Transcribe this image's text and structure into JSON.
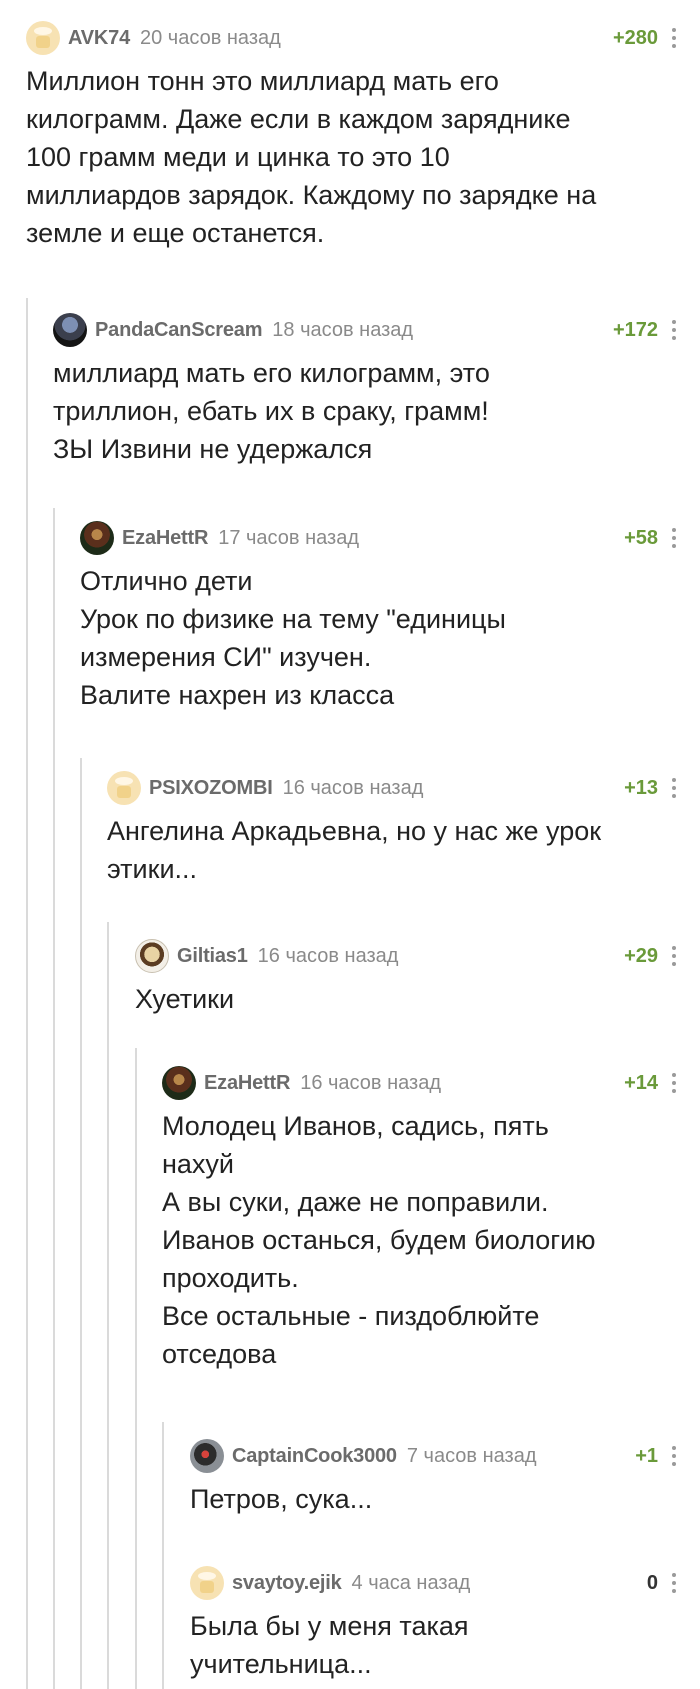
{
  "comments": [
    {
      "username": "AVK74",
      "time": "20 часов назад",
      "rating": "+280",
      "avatar": "default-cheese-avatar",
      "lines": [
        "Миллион тонн это миллиард мать его",
        "килограмм. Даже если в каждом заряднике",
        "100 грамм меди и цинка то это 10",
        "миллиардов зарядок. Каждому по зарядке на",
        "земле и еще останется."
      ]
    },
    {
      "username": "PandaCanScream",
      "time": "18 часов назад",
      "rating": "+172",
      "avatar": "user-avatar",
      "lines": [
        "миллиард мать его килограмм, это",
        "триллион, ебать их в сраку, грамм!",
        "ЗЫ Извини не удержался"
      ]
    },
    {
      "username": "EzaHettR",
      "time": "17 часов назад",
      "rating": "+58",
      "avatar": "user-avatar",
      "lines": [
        "Отлично дети",
        "Урок по физике на тему \"единицы",
        "измерения СИ\" изучен.",
        "Валите нахрен из класса"
      ]
    },
    {
      "username": "PSIXOZOMBI",
      "time": "16 часов назад",
      "rating": "+13",
      "avatar": "default-cheese-avatar",
      "lines": [
        "Ангелина Аркадьевна, но у нас же урок",
        "этики..."
      ]
    },
    {
      "username": "Giltias1",
      "time": "16 часов назад",
      "rating": "+29",
      "avatar": "user-avatar",
      "lines": [
        "Хуетики"
      ]
    },
    {
      "username": "EzaHettR",
      "time": "16 часов назад",
      "rating": "+14",
      "avatar": "user-avatar",
      "lines": [
        "Молодец Иванов, садись, пять",
        "нахуй",
        "А вы суки, даже не поправили.",
        "Иванов останься, будем биологию",
        "проходить.",
        "Все остальные - пиздоблюйте",
        "отседова"
      ]
    },
    {
      "username": "CaptainCook3000",
      "time": "7 часов назад",
      "rating": "+1",
      "avatar": "user-avatar",
      "lines": [
        "Петров, сука..."
      ]
    },
    {
      "username": "svaytoy.ejik",
      "time": "4 часа назад",
      "rating": "0",
      "avatar": "default-cheese-avatar",
      "lines": [
        "Была бы у меня такая",
        "учительница..."
      ]
    }
  ],
  "colors": {
    "positive_rating": "#6a9a3a",
    "neutral_rating": "#333333",
    "thread_line": "#dadada"
  }
}
